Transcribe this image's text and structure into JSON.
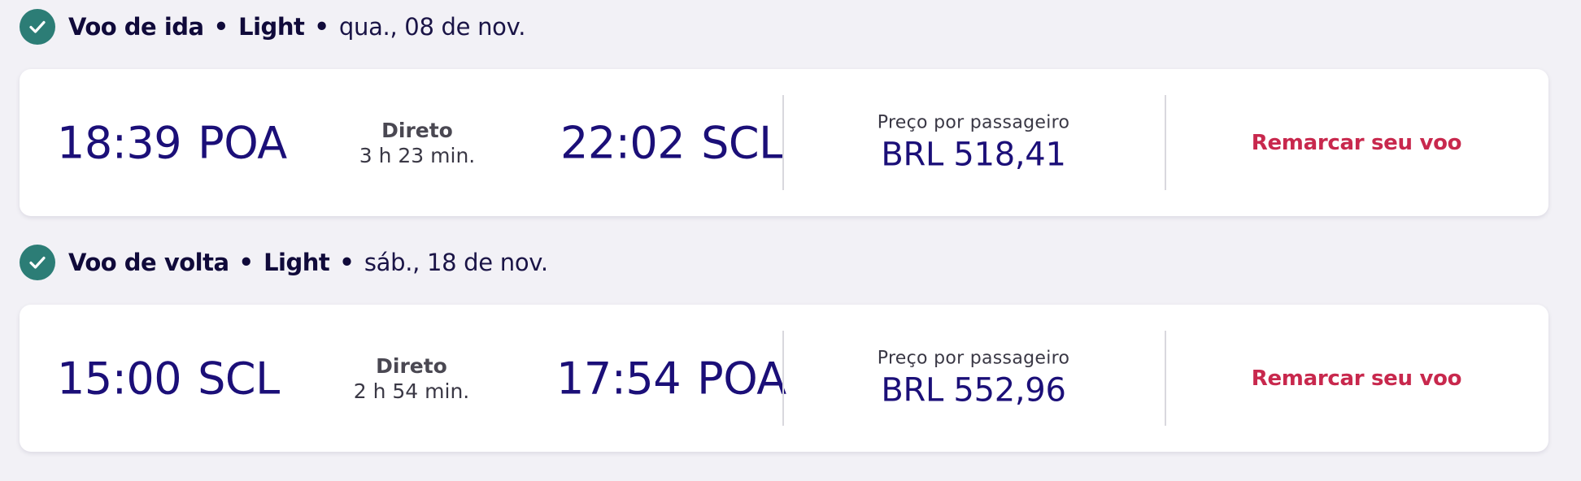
{
  "flights": [
    {
      "header": {
        "title": "Voo de ida",
        "fare": "Light",
        "date": "qua., 08 de nov."
      },
      "departure": {
        "time": "18:39",
        "airport": "POA"
      },
      "stops": "Direto",
      "duration": "3 h 23 min.",
      "arrival": {
        "time": "22:02",
        "airport": "SCL"
      },
      "price_label": "Preço por passageiro",
      "price": "BRL 518,41",
      "rebook_label": "Remarcar seu voo"
    },
    {
      "header": {
        "title": "Voo de volta",
        "fare": "Light",
        "date": "sáb., 18 de nov."
      },
      "departure": {
        "time": "15:00",
        "airport": "SCL"
      },
      "stops": "Direto",
      "duration": "2 h 54 min.",
      "arrival": {
        "time": "17:54",
        "airport": "POA"
      },
      "price_label": "Preço por passageiro",
      "price": "BRL 552,96",
      "rebook_label": "Remarcar seu voo"
    }
  ],
  "colors": {
    "check": "#2c7d76",
    "time": "#1b0f78",
    "rebook": "#c8284d",
    "background": "#f2f1f6"
  }
}
